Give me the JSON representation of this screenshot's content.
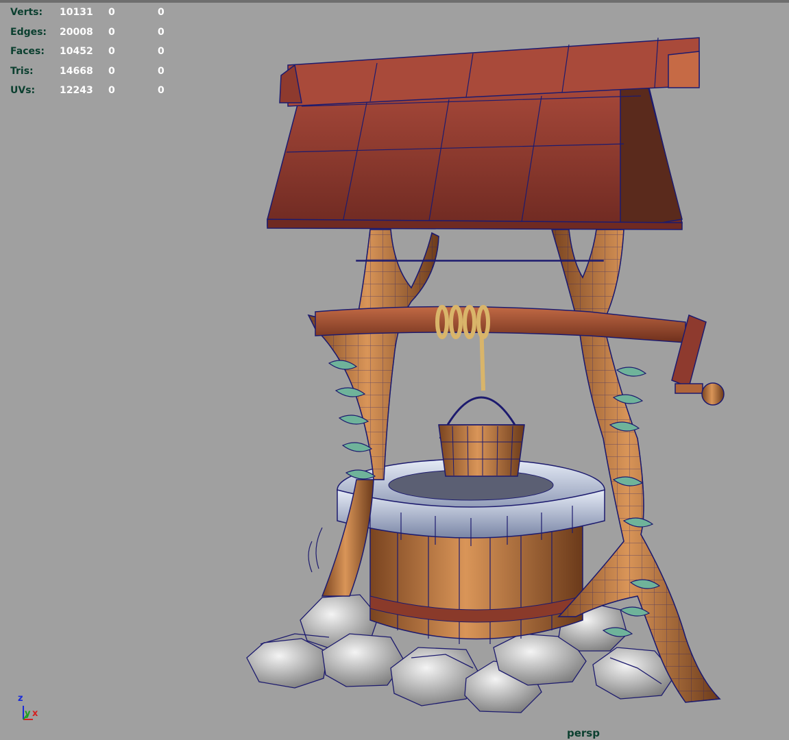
{
  "hud": {
    "rows": [
      {
        "label": "Verts:",
        "v1": "10131",
        "v2": "0",
        "v3": "0"
      },
      {
        "label": "Edges:",
        "v1": "20008",
        "v2": "0",
        "v3": "0"
      },
      {
        "label": "Faces:",
        "v1": "10452",
        "v2": "0",
        "v3": "0"
      },
      {
        "label": "Tris:",
        "v1": "14668",
        "v2": "0",
        "v3": "0"
      },
      {
        "label": "UVs:",
        "v1": "12243",
        "v2": "0",
        "v3": "0"
      }
    ]
  },
  "camera": {
    "name": "persp"
  },
  "axis": {
    "z": "z",
    "y": "y",
    "x": "x"
  },
  "colors": {
    "viewport_bg": "#a0a0a0",
    "wire": "#1c1a6e",
    "roof": "#8e3a2e",
    "wood": "#b8733e",
    "stone_rim": "#aab4cc",
    "rocks": "#d8d8d8",
    "leaves": "#6fb39a",
    "hud_label": "#0b3f2f",
    "hud_value": "#ffffff"
  }
}
